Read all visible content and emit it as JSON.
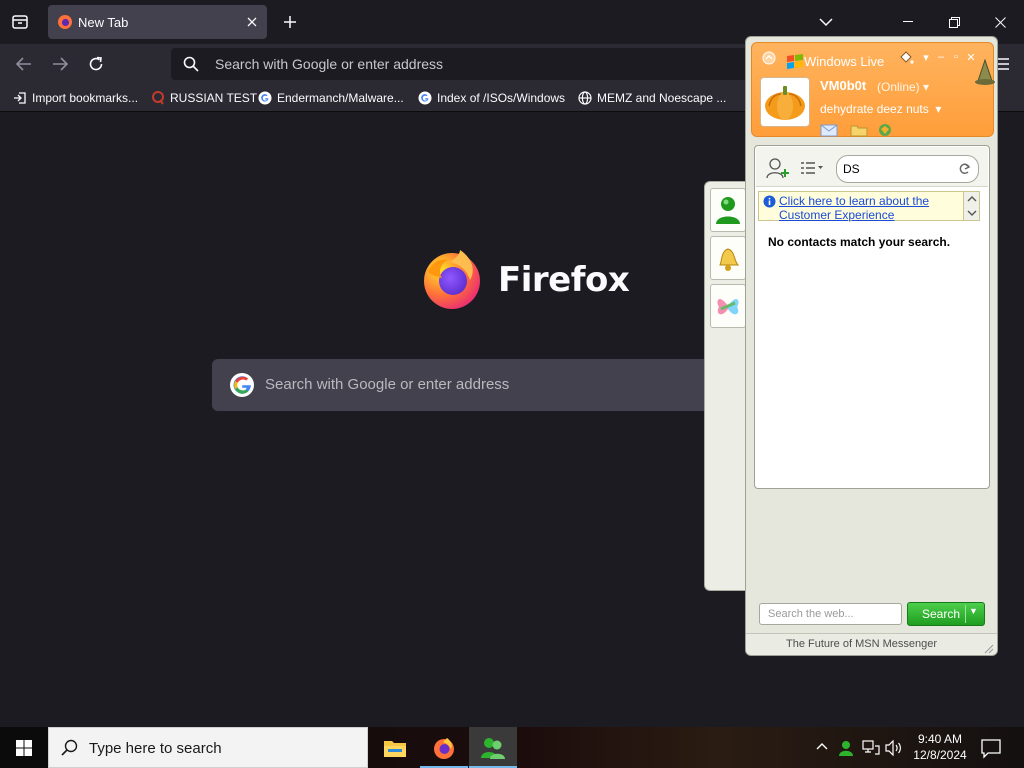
{
  "browser": {
    "tab": {
      "title": "New Tab"
    },
    "urlbar": {
      "placeholder": "Search with Google or enter address"
    },
    "bookmarks": [
      {
        "label": "Import bookmarks...",
        "icon": "import-icon"
      },
      {
        "label": "RUSSIAN TEST",
        "icon": "favicon"
      },
      {
        "label": "Endermanch/Malware...",
        "icon": "google-icon"
      },
      {
        "label": "Index of /ISOs/Windows",
        "icon": "google-icon"
      },
      {
        "label": "MEMZ and Noescape ...",
        "icon": "globe-icon"
      }
    ],
    "newtab": {
      "wordmark": "Firefox",
      "search_placeholder": "Search with Google or enter address"
    },
    "colors": {
      "chrome": "#1c1b22",
      "toolbar": "#2b2a33",
      "field": "#42414d"
    }
  },
  "msn": {
    "title": "Windows Live",
    "user": {
      "name": "VM0b0t",
      "status": "(Online)",
      "personal_message": "dehydrate deez nuts"
    },
    "search_contacts": {
      "value": "DS"
    },
    "banner": {
      "link": "Click here to learn about the Customer Experience"
    },
    "empty_message": "No contacts match your search.",
    "web_search": {
      "placeholder": "Search the web...",
      "button": "Search"
    },
    "footer": "The Future of MSN Messenger",
    "colors": {
      "header": "#ff9e3a",
      "search_button": "#2db32d"
    }
  },
  "taskbar": {
    "search_text": "Type here to search",
    "clock": {
      "time": "9:40 AM",
      "date": "12/8/2024"
    },
    "apps": [
      "file-explorer-icon",
      "firefox-icon",
      "msn-messenger-icon"
    ]
  }
}
